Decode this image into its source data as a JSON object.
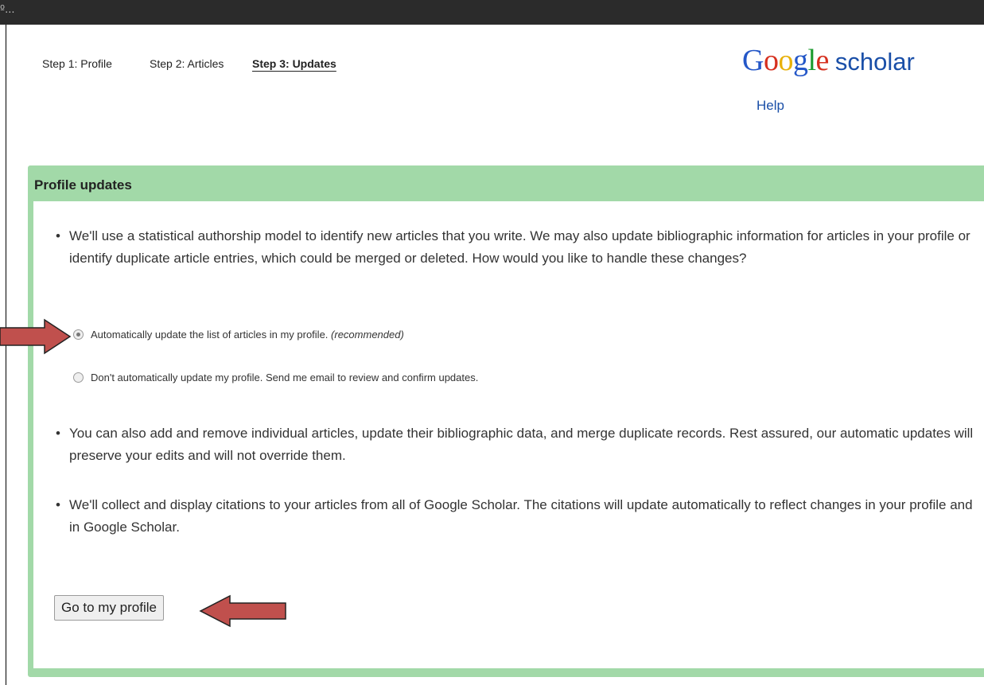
{
  "window": {
    "title_fragment": "º..."
  },
  "steps": {
    "step1": "Step 1: Profile",
    "step2": "Step 2: Articles",
    "step3": "Step 3: Updates",
    "active": "step3"
  },
  "logo": {
    "google_letters": [
      "G",
      "o",
      "o",
      "g",
      "l",
      "e"
    ],
    "scholar": "scholar"
  },
  "help_link": "Help",
  "panel": {
    "title": "Profile updates",
    "bullets": [
      "We'll use a statistical authorship model to identify new articles that you write. We may also update bibliographic information for articles in your profile or identify duplicate article entries, which could be merged or deleted. How would you like to handle these changes?",
      "You can also add and remove individual articles, update their bibliographic data, and merge duplicate records. Rest assured, our automatic updates will preserve your edits and will not override them.",
      "We'll collect and display citations to your articles from all of Google Scholar. The citations will update automatically to reflect changes in your profile and in Google Scholar."
    ],
    "options": [
      {
        "label": "Automatically update the list of articles in my profile.",
        "note": "(recommended)",
        "selected": true
      },
      {
        "label": "Don't automatically update my profile. Send me email to review and confirm updates.",
        "note": "",
        "selected": false
      }
    ],
    "button": "Go to my profile"
  },
  "annotations": {
    "arrow_color": "#c0504d"
  },
  "colors": {
    "topbar": "#2b2b2b",
    "panel_green": "#a2d9a8",
    "link_blue": "#1a4fa8"
  }
}
